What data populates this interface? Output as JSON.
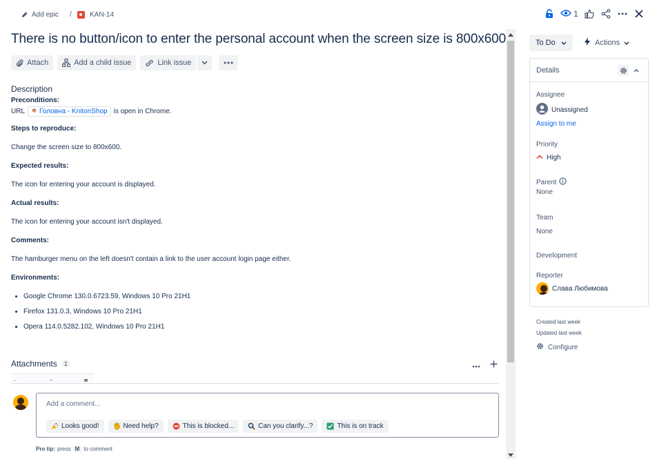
{
  "breadcrumb": {
    "add_epic": "Add epic",
    "separator": "/",
    "issue_key": "KAN-14"
  },
  "header": {
    "watch_count": "1",
    "icons": [
      "lock-icon",
      "eye-icon",
      "thumbs-up-icon",
      "share-icon",
      "more-icon",
      "close-icon"
    ]
  },
  "issue": {
    "title": "There is no button/icon to enter the personal account when the screen size is 800x600"
  },
  "toolbar": {
    "attach": "Attach",
    "add_child": "Add a child issue",
    "link_issue": "Link issue"
  },
  "description": {
    "heading": "Description",
    "preconditions_h": "Preconditions:",
    "url_prefix": "URL",
    "url_link": "Головна - KnitonShop",
    "url_suffix": "is open in Chrome.",
    "steps_h": "Steps to reproduce:",
    "steps": "Change the screen size to 800x600.",
    "expected_h": "Expected results:",
    "expected": "The icon for entering your account is displayed.",
    "actual_h": "Actual results:",
    "actual": "The icon for entering your account isn't displayed.",
    "comments_h": "Comments:",
    "comments": "The hamburger menu on the left doesn't contain a link to the user account login page either.",
    "env_h": "Environments:",
    "envs": [
      "Google Chrome 130.0.6723.59, Windows 10 Pro 21H1",
      "Firefox 131.0.3, Windows 10 Pro 21H1",
      "Opera 114.0.5282.102, Windows 10 Pro 21H1"
    ]
  },
  "attachments": {
    "label": "Attachments",
    "count": "1"
  },
  "comment": {
    "placeholder": "Add a comment...",
    "chips": [
      "Looks good!",
      "Need help?",
      "This is blocked...",
      "Can you clarify...?",
      "This is on track"
    ],
    "protip_label": "Pro tip:",
    "protip_press": "press",
    "protip_key": "M",
    "protip_suffix": "to comment"
  },
  "sidebar": {
    "status": "To Do",
    "actions": "Actions",
    "details_title": "Details",
    "assignee_label": "Assignee",
    "assignee_value": "Unassigned",
    "assign_to_me": "Assign to me",
    "priority_label": "Priority",
    "priority_value": "High",
    "parent_label": "Parent",
    "parent_value": "None",
    "team_label": "Team",
    "team_value": "None",
    "development_label": "Development",
    "reporter_label": "Reporter",
    "reporter_value": "Слава Любимова",
    "created": "Created last week",
    "updated": "Updated last week",
    "configure": "Configure"
  },
  "colors": {
    "link": "#0c66e4",
    "bug": "#e2483d",
    "priority_high": "#e2483d",
    "avatar": "#ffab00"
  }
}
